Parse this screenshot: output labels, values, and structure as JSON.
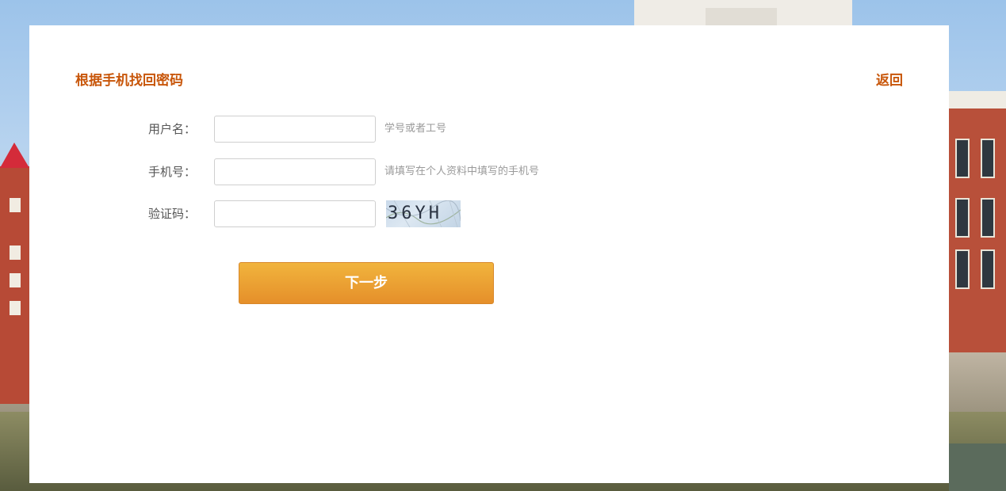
{
  "page": {
    "title": "根据手机找回密码",
    "back_label": "返回"
  },
  "form": {
    "username": {
      "label": "用户名：",
      "value": "",
      "hint": "学号或者工号"
    },
    "phone": {
      "label": "手机号：",
      "value": "",
      "hint": "请填写在个人资料中填写的手机号"
    },
    "captcha": {
      "label": "验证码：",
      "value": "",
      "image_text": "36YH"
    },
    "next_label": "下一步"
  },
  "colors": {
    "accent": "#c8560a",
    "button_top": "#f1b43d",
    "button_bottom": "#e58f2a",
    "label": "#555555",
    "hint": "#9a9a9a"
  }
}
